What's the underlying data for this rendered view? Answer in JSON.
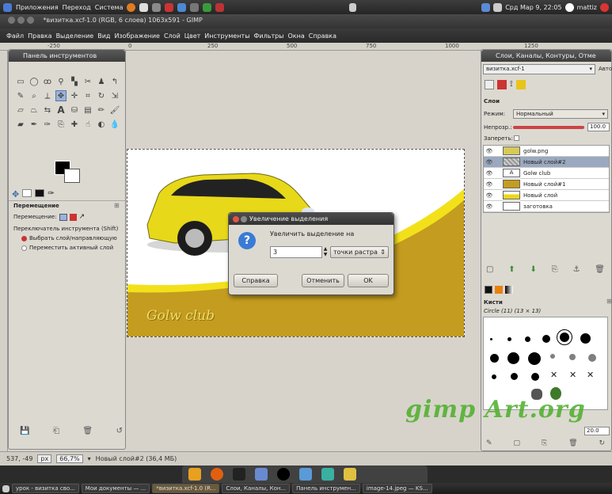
{
  "topbar": {
    "menu": [
      "Приложения",
      "Переход",
      "Система"
    ],
    "clock": "Срд Мар 9, 22:05",
    "user": "mattiz"
  },
  "window": {
    "title": "*визитка.xcf-1.0 (RGB, 6 слоев) 1063x591 - GIMP"
  },
  "menubar": [
    "Файл",
    "Правка",
    "Выделение",
    "Вид",
    "Изображение",
    "Слой",
    "Цвет",
    "Инструменты",
    "Фильтры",
    "Окна",
    "Справка"
  ],
  "ruler": [
    "-250",
    "0",
    "250",
    "500",
    "750",
    "1000",
    "1250"
  ],
  "toolbox": {
    "title": "Панель инструментов",
    "options_title": "Перемещение",
    "move_label": "Перемещение:",
    "switch_label": "Переключатель инструмента (Shift)",
    "option1": "Выбрать слой/направляющую",
    "option2": "Переместить активный слой"
  },
  "image": {
    "text": "Golw club"
  },
  "dialog": {
    "title": "Увеличение выделения",
    "label": "Увеличить выделение на",
    "value": "3",
    "unit": "точки растра",
    "help": "Справка",
    "cancel": "Отменить",
    "ok": "OK"
  },
  "layers_panel": {
    "title": "Слои, Каналы, Контуры, Отме",
    "image_select": "визитка.xcf-1",
    "auto": "Авто",
    "section": "Слои",
    "mode_label": "Режим:",
    "mode_value": "Нормальный",
    "opacity_label": "Непрозр.:",
    "opacity_value": "100.0",
    "lock_label": "Запереть:",
    "layers": [
      {
        "name": "golw.png",
        "selected": false
      },
      {
        "name": "Новый слой#2",
        "selected": true
      },
      {
        "name": "Golw club",
        "selected": false
      },
      {
        "name": "Новый слой#1",
        "selected": false
      },
      {
        "name": "Новый слой",
        "selected": false
      },
      {
        "name": "заготовка",
        "selected": false
      }
    ]
  },
  "brushes_panel": {
    "title": "Кисти",
    "brush": "Circle (11) (13 × 13)",
    "spacing": "20.0"
  },
  "statusbar": {
    "coords": "537, -49",
    "unit": "px",
    "zoom": "66,7%",
    "layer_info": "Новый слой#2 (36,4 МБ)"
  },
  "taskbar": [
    {
      "label": "урок - визитка сво...",
      "active": false
    },
    {
      "label": "Мои документы — ...",
      "active": false
    },
    {
      "label": "*визитка.xcf-1.0 (R...",
      "active": true
    },
    {
      "label": "Слои, Каналы, Кон...",
      "active": false
    },
    {
      "label": "Панель инструмен...",
      "active": false
    },
    {
      "label": "image-14.jpeg — KS...",
      "active": false
    }
  ],
  "watermark": "gimp Art.org",
  "colors": {
    "accent_yellow": "#c49c1f",
    "car": "#e8d81a",
    "selected_layer": "#9aa9c0",
    "selected_tool": "#9ab3d6"
  }
}
